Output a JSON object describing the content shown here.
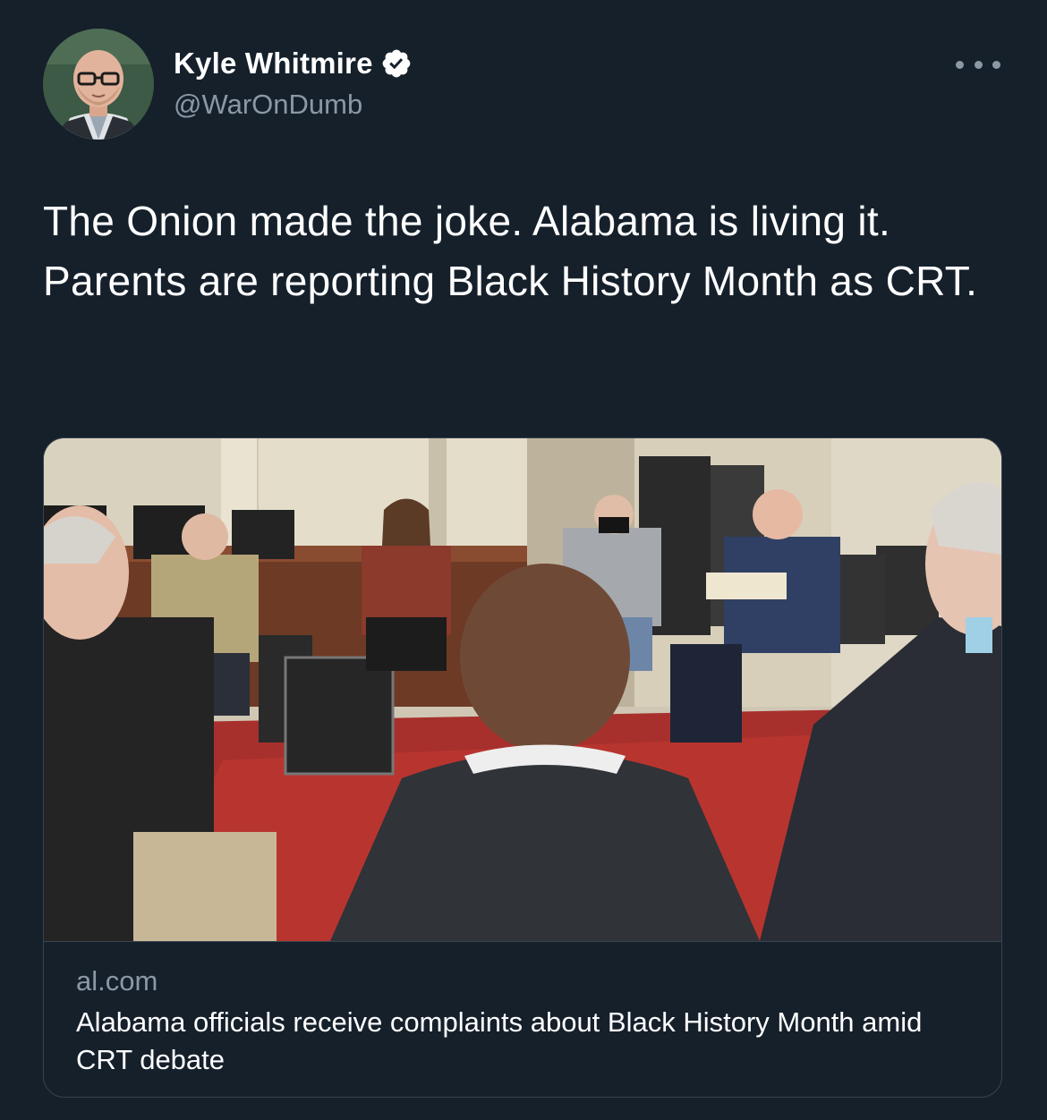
{
  "colors": {
    "background": "#15202b",
    "primary_text": "#ffffff",
    "secondary_text": "#8b98a5",
    "border": "#38444d",
    "verified_badge": "#ffffff"
  },
  "author": {
    "name": "Kyle Whitmire",
    "handle": "@WarOnDumb",
    "verified": true,
    "avatar_icon": "profile-photo-man-with-glasses"
  },
  "more_menu": {
    "icon": "more-horizontal-icon"
  },
  "tweet": {
    "text": "The Onion made the joke. Alabama is living it. Parents are reporting Black History Month as CRT."
  },
  "link_card": {
    "image": "photo-of-meeting-circle-of-officials-in-chairs",
    "domain": "al.com",
    "title": "Alabama officials receive complaints about Black History Month amid CRT debate"
  }
}
